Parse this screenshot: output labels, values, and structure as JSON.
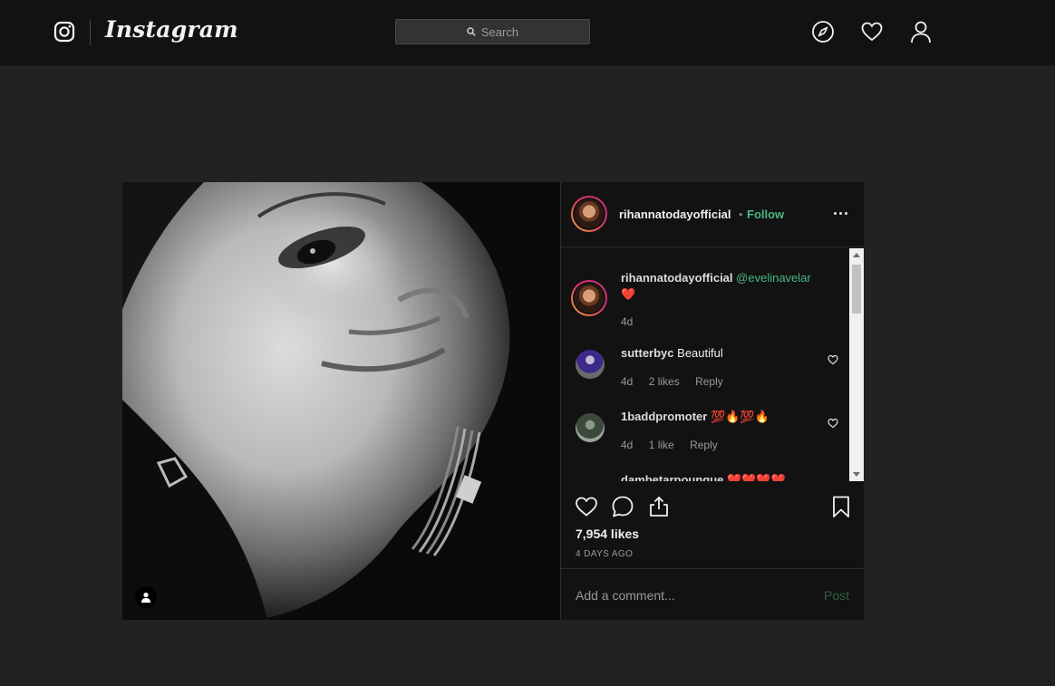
{
  "header": {
    "brand": "Instagram",
    "search_placeholder": "Search"
  },
  "post": {
    "author": "rihannatodayofficial",
    "separator": "•",
    "follow_label": "Follow",
    "caption": {
      "user": "rihannatodayofficial",
      "mention": "@evelinavelar",
      "emoji": "❤️",
      "time": "4d"
    },
    "comments": [
      {
        "user": "sutterbyc",
        "text": "Beautiful",
        "time": "4d",
        "likes": "2 likes",
        "reply": "Reply"
      },
      {
        "user": "1baddpromoter",
        "text": "💯🔥💯🔥",
        "time": "4d",
        "likes": "1 like",
        "reply": "Reply"
      },
      {
        "user": "dambetarpounque",
        "text": "❤️❤️❤️❤️"
      }
    ],
    "likes": "7,954 likes",
    "date": "4 DAYS AGO",
    "comment_placeholder": "Add a comment...",
    "post_label": "Post"
  },
  "colors": {
    "accent_green": "#4cb782",
    "background": "#222222",
    "card": "#121212"
  }
}
